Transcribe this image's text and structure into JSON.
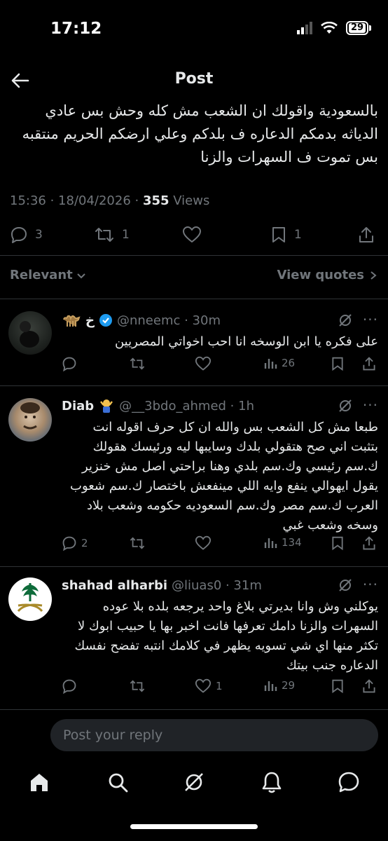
{
  "status": {
    "time": "17:12",
    "battery": "29"
  },
  "header": {
    "title": "Post"
  },
  "post": {
    "text": "بالسعودية واقولك ان الشعب مش كله وحش بس عادي الدياثه بدمكم الدعاره ف بلدكم وعلي ارضكم الحريم منتقبه بس تموت ف السهرات والزنا",
    "timestamp": "15:36 · 18/04/2026 · ",
    "views_count": "355",
    "views_label": " Views",
    "replies": "3",
    "reposts": "1",
    "bookmarks": "1"
  },
  "filter": {
    "sort_label": "Relevant",
    "quotes_label": "View quotes"
  },
  "replies": [
    {
      "name": "خ",
      "handle": "@nneemc · 30m",
      "text": "على فكره يا ابن الوسخه انا احب اخواتي المصريين",
      "views": "26",
      "replies": "",
      "reposts": "",
      "likes": ""
    },
    {
      "name": "Diab",
      "handle": "@__3bdo_ahmed · 1h",
      "text": "طبعا مش كل الشعب بس والله ان كل حرف اقوله انت بتثبت اني صح هتقولي بلدك وسايبها ليه ورئيسك هقولك ك.سم رئيسي وك.سم بلدي وهنا براحتي اصل مش خنزير يقول ايهوالي ينفع وايه اللي مينفعش باختصار ك.سم شعوب العرب ك.سم مصر وك.سم السعوديه حكومه وشعب بلاد وسخه وشعب غبي",
      "views": "134",
      "replies": "2",
      "reposts": "",
      "likes": ""
    },
    {
      "name": "shahad alharbi",
      "handle": "@liuas0 · 31m",
      "text": "يوكلني وش وانا بديرتي بلاغ واحد يرجعه بلده بلا عوده السهرات والزنا دامك تعرفها فانت اخبر بها يا حبيب ابوك لا تكثر منها اي شي تسويه يظهر في كلامك انتبه تفضح نفسك الدعاره جنب بيتك",
      "views": "29",
      "replies": "",
      "reposts": "",
      "likes": "1"
    }
  ],
  "compose": {
    "placeholder": "Post your reply"
  },
  "nav": [
    "home-icon",
    "search-icon",
    "grok-icon",
    "notifications-icon",
    "messages-icon"
  ],
  "colors": {
    "background": "#000000",
    "text": "#e7e9ea",
    "muted": "#71767b",
    "verified": "#1d9bf0",
    "divider": "#2f3336"
  }
}
